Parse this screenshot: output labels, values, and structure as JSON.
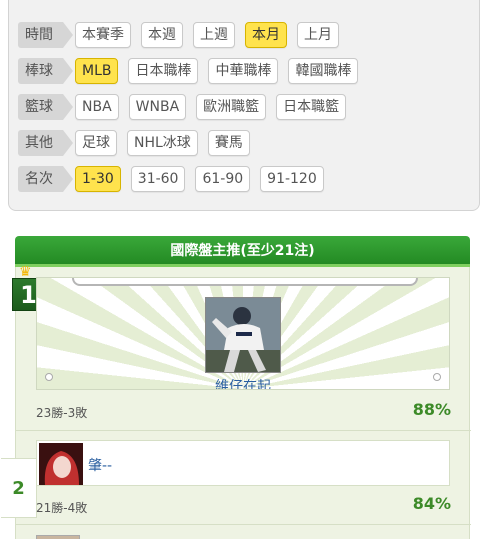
{
  "filters": [
    {
      "label": "時間",
      "options": [
        "本賽季",
        "本週",
        "上週",
        "本月",
        "上月"
      ],
      "active": 3
    },
    {
      "label": "棒球",
      "options": [
        "MLB",
        "日本職棒",
        "中華職棒",
        "韓國職棒"
      ],
      "active": 0
    },
    {
      "label": "籃球",
      "options": [
        "NBA",
        "WNBA",
        "歐洲職籃",
        "日本職籃"
      ],
      "active": -1
    },
    {
      "label": "其他",
      "options": [
        "足球",
        "NHL冰球",
        "賽馬"
      ],
      "active": -1
    },
    {
      "label": "名次",
      "options": [
        "1-30",
        "31-60",
        "61-90",
        "91-120"
      ],
      "active": 0
    }
  ],
  "ranking": {
    "title": "國際盤主推(至少21注)",
    "entries": [
      {
        "rank": "1",
        "name": "維仔在起",
        "record": "23勝-3敗",
        "percent": "88%"
      },
      {
        "rank": "2",
        "name": "肇--",
        "record": "21勝-4敗",
        "percent": "84%"
      }
    ]
  },
  "colors": {
    "active_chip": "#ffe34d",
    "header_green": "#2a962a",
    "percent_green": "#3c8a28"
  }
}
